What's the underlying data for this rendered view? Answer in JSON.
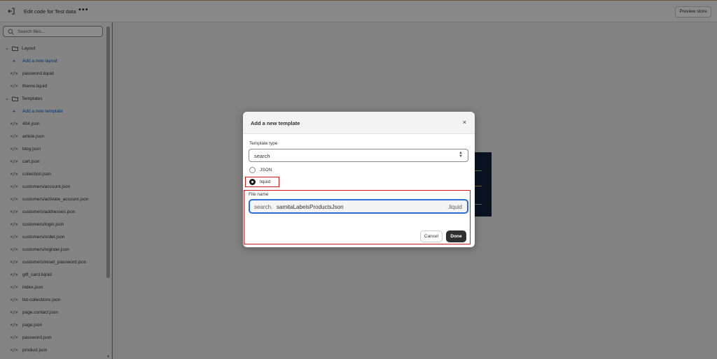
{
  "topbar": {
    "title": "Edit code for Test data",
    "more": "•••",
    "preview_label": "Preview store"
  },
  "sidebar": {
    "search_placeholder": "Search files...",
    "tree": [
      {
        "type": "folder",
        "label": "Layout",
        "icon": "folder-icon"
      },
      {
        "type": "add",
        "label": "Add a new layout",
        "icon": "plus-icon"
      },
      {
        "type": "file",
        "label": "password.liquid",
        "icon": "code-icon"
      },
      {
        "type": "file",
        "label": "theme.liquid",
        "icon": "code-icon"
      },
      {
        "type": "folder",
        "label": "Templates",
        "icon": "folder-icon"
      },
      {
        "type": "add",
        "label": "Add a new template",
        "icon": "plus-icon"
      },
      {
        "type": "file",
        "label": "404.json",
        "icon": "code-icon"
      },
      {
        "type": "file",
        "label": "article.json",
        "icon": "code-icon"
      },
      {
        "type": "file",
        "label": "blog.json",
        "icon": "code-icon"
      },
      {
        "type": "file",
        "label": "cart.json",
        "icon": "code-icon"
      },
      {
        "type": "file",
        "label": "collection.json",
        "icon": "code-icon"
      },
      {
        "type": "file",
        "label": "customers/account.json",
        "icon": "code-icon"
      },
      {
        "type": "file",
        "label": "customers/activate_account.json",
        "icon": "code-icon"
      },
      {
        "type": "file",
        "label": "customers/addresses.json",
        "icon": "code-icon"
      },
      {
        "type": "file",
        "label": "customers/login.json",
        "icon": "code-icon"
      },
      {
        "type": "file",
        "label": "customers/order.json",
        "icon": "code-icon"
      },
      {
        "type": "file",
        "label": "customers/register.json",
        "icon": "code-icon"
      },
      {
        "type": "file",
        "label": "customers/reset_password.json",
        "icon": "code-icon"
      },
      {
        "type": "file",
        "label": "gift_card.liquid",
        "icon": "code-icon"
      },
      {
        "type": "file",
        "label": "index.json",
        "icon": "code-icon"
      },
      {
        "type": "file",
        "label": "list-collections.json",
        "icon": "code-icon"
      },
      {
        "type": "file",
        "label": "page.contact.json",
        "icon": "code-icon"
      },
      {
        "type": "file",
        "label": "page.json",
        "icon": "code-icon"
      },
      {
        "type": "file",
        "label": "password.json",
        "icon": "code-icon"
      },
      {
        "type": "file",
        "label": "product.json",
        "icon": "code-icon"
      }
    ]
  },
  "modal": {
    "title": "Add a new template",
    "close": "×",
    "template_type_label": "Template type",
    "template_type_value": "search",
    "radio_json": "JSON",
    "radio_liquid": "liquid",
    "selected": "liquid",
    "file_name_label": "File name",
    "file_prefix": "search.",
    "file_value": "samitaLabelsProductsJson",
    "file_suffix": ".liquid",
    "cancel_label": "Cancel",
    "done_label": "Done"
  },
  "colors": {
    "accent": "#005bd3",
    "focus": "#2a6fd6",
    "highlight": "#d01818",
    "primary_button": "#303030"
  }
}
